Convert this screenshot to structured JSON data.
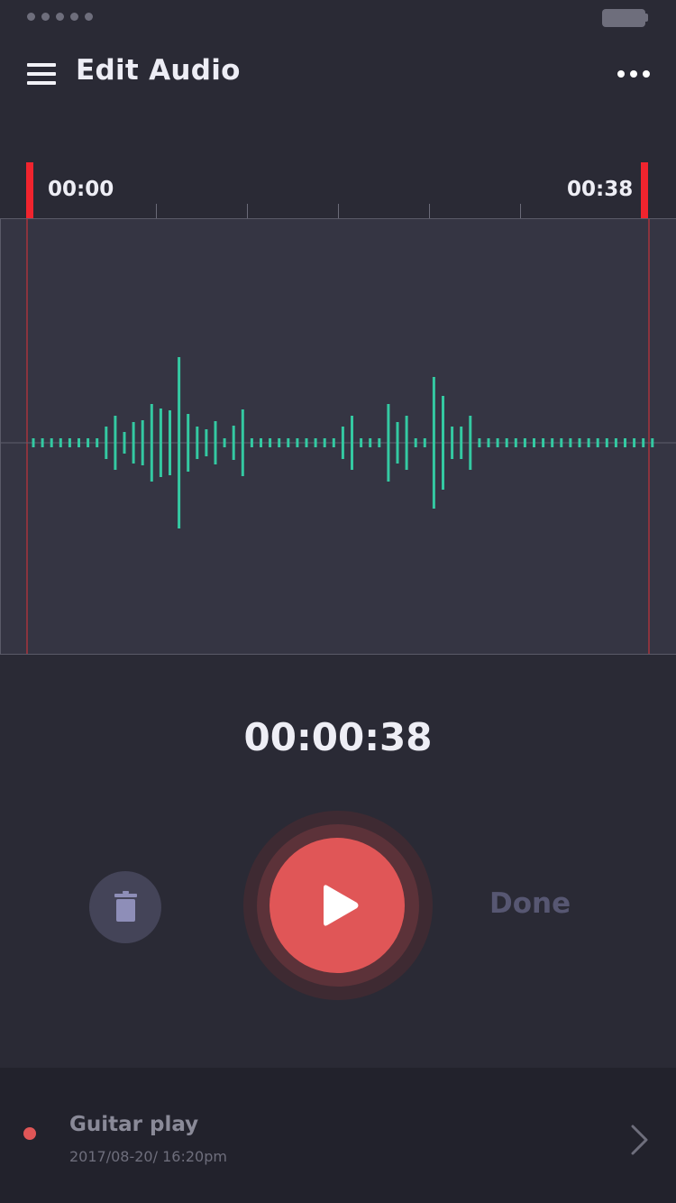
{
  "status_bar": {
    "signal_dots": 5
  },
  "header": {
    "title": "Edit Audio"
  },
  "ruler": {
    "start_time": "00:00",
    "end_time": "00:38",
    "tick_count": 5
  },
  "waveform": {
    "color": "#34c9a2",
    "amplitudes": [
      5,
      5,
      5,
      5,
      5,
      5,
      5,
      5,
      18,
      30,
      12,
      23,
      25,
      43,
      38,
      36,
      95,
      32,
      18,
      15,
      24,
      5,
      19,
      37,
      5,
      5,
      5,
      5,
      5,
      5,
      5,
      5,
      5,
      5,
      18,
      30,
      5,
      5,
      5,
      43,
      23,
      30,
      5,
      5,
      73,
      52,
      18,
      18,
      30,
      5,
      5,
      5,
      5,
      5,
      5,
      5,
      5,
      5,
      5,
      5,
      5,
      5,
      5,
      5,
      5,
      5,
      5,
      5,
      5
    ]
  },
  "player": {
    "elapsed": "00:00:38",
    "done_label": "Done",
    "accent_color": "#e05657"
  },
  "recording": {
    "title": "Guitar play",
    "date": "2017/08-20/ 16:20pm"
  }
}
